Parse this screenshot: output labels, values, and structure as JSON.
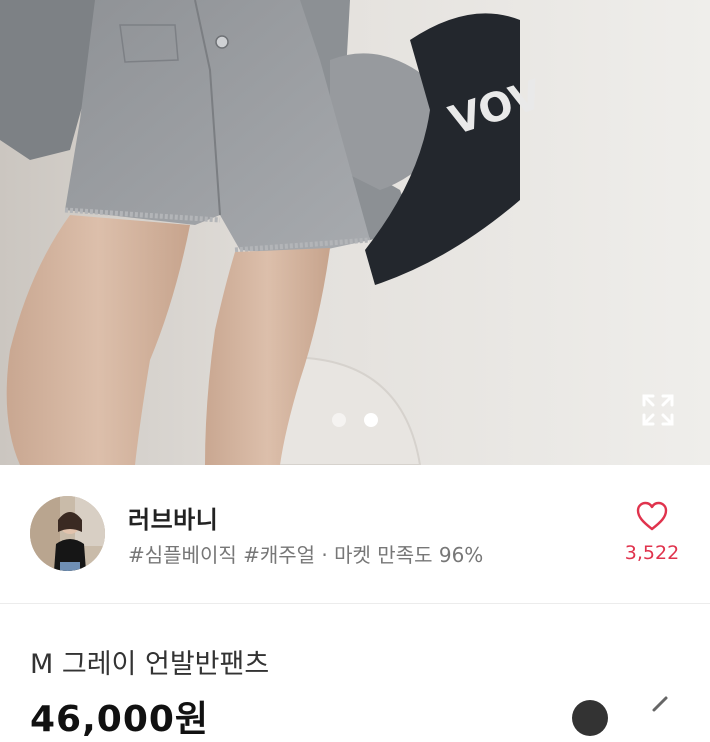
{
  "photo": {
    "bag_text": "VOV",
    "page_count": 2,
    "active_page": 2,
    "expand_icon": "expand-icon"
  },
  "seller": {
    "name": "러브바니",
    "meta": "#심플베이직 #캐주얼 · 마켓 만족도 96%",
    "like_count": "3,522",
    "like_icon": "heart-outline-icon"
  },
  "item": {
    "title": "M 그레이 언발반팬츠",
    "price": "46,000원"
  },
  "colors": {
    "accent": "#e0334d",
    "text": "#222222",
    "muted": "#777777",
    "divider": "#ececec"
  }
}
